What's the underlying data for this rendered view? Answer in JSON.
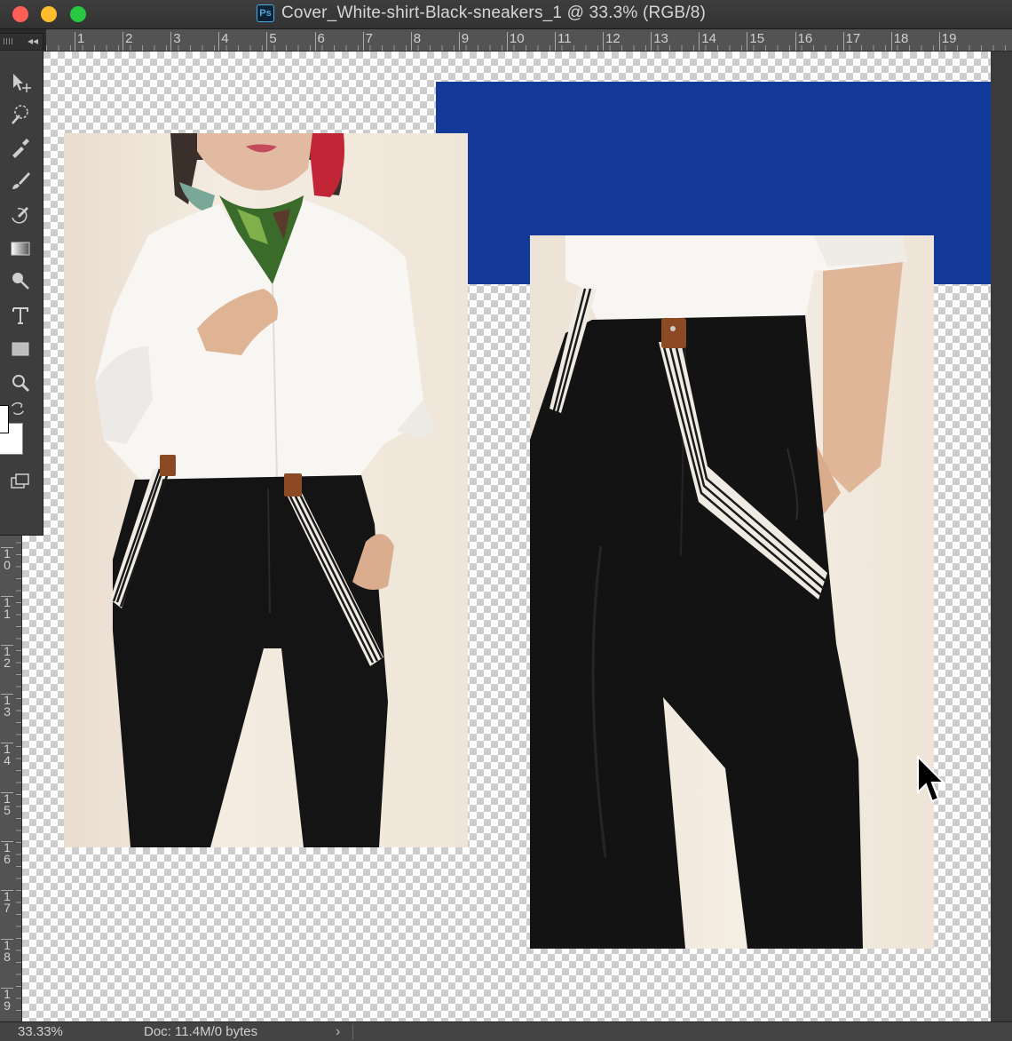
{
  "window": {
    "title": "Cover_White-shirt-Black-sneakers_1 @ 33.3% (RGB/8)",
    "app_badge": "Ps"
  },
  "ruler_top": {
    "labels": [
      "1",
      "2",
      "3",
      "4",
      "5",
      "6",
      "7",
      "8",
      "9",
      "10",
      "11",
      "12",
      "13",
      "14",
      "15",
      "16",
      "17",
      "18",
      "19"
    ]
  },
  "ruler_left": {
    "labels": [
      "1\n0",
      "1\n1",
      "1\n2",
      "1\n3",
      "1\n4",
      "1\n5",
      "1\n6",
      "1\n7",
      "1\n8",
      "1\n9"
    ]
  },
  "toolbar": {
    "collapse_glyph": "◂◂",
    "tools": [
      "move-tool",
      "quick-selection-tool",
      "eyedropper-tool",
      "brush-tool",
      "history-brush-tool",
      "gradient-tool",
      "dodge-tool",
      "type-tool",
      "rectangle-tool",
      "zoom-tool"
    ]
  },
  "canvas": {
    "accent_color": "#133a9a",
    "photos": [
      "white-shirt-suspenders-full",
      "white-shirt-suspenders-closeup"
    ]
  },
  "statusbar": {
    "zoom": "33.33%",
    "doc": "Doc: 11.4M/0 bytes",
    "arrow": "›"
  }
}
